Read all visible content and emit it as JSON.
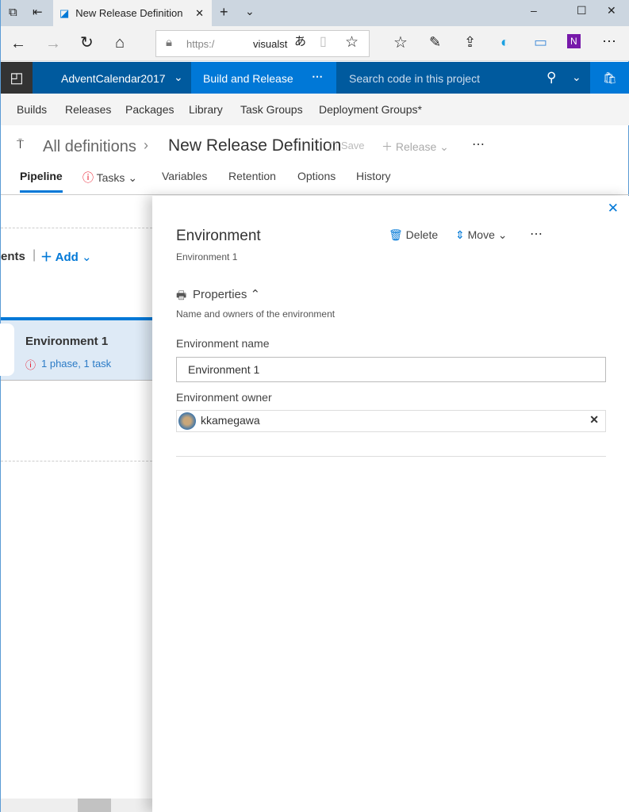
{
  "browser": {
    "tab_title": "New Release Definition",
    "url_prefix": "https:/",
    "url_host": "visualst"
  },
  "vsts": {
    "project": "AdventCalendar2017",
    "hub": "Build and Release",
    "search_placeholder": "Search code in this project",
    "colors": {
      "bar": "#005a9e",
      "active": "#0078d7"
    }
  },
  "hubs": [
    "Builds",
    "Releases",
    "Packages",
    "Library",
    "Task Groups",
    "Deployment Groups*"
  ],
  "header": {
    "breadcrumb": "All definitions",
    "title": "New Release Definition",
    "save": "Save",
    "release": "Release"
  },
  "tabs": [
    "Pipeline",
    "Tasks",
    "Variables",
    "Retention",
    "Options",
    "History"
  ],
  "pipeline": {
    "section_partial": "ents",
    "add": "Add",
    "env_name": "Environment 1",
    "env_summary": "1 phase, 1 task"
  },
  "panel": {
    "title": "Environment",
    "subtitle": "Environment 1",
    "delete": "Delete",
    "move": "Move",
    "properties": "Properties",
    "properties_desc": "Name and owners of the environment",
    "name_label": "Environment name",
    "name_value": "Environment 1",
    "owner_label": "Environment owner",
    "owner_value": "kkamegawa"
  }
}
